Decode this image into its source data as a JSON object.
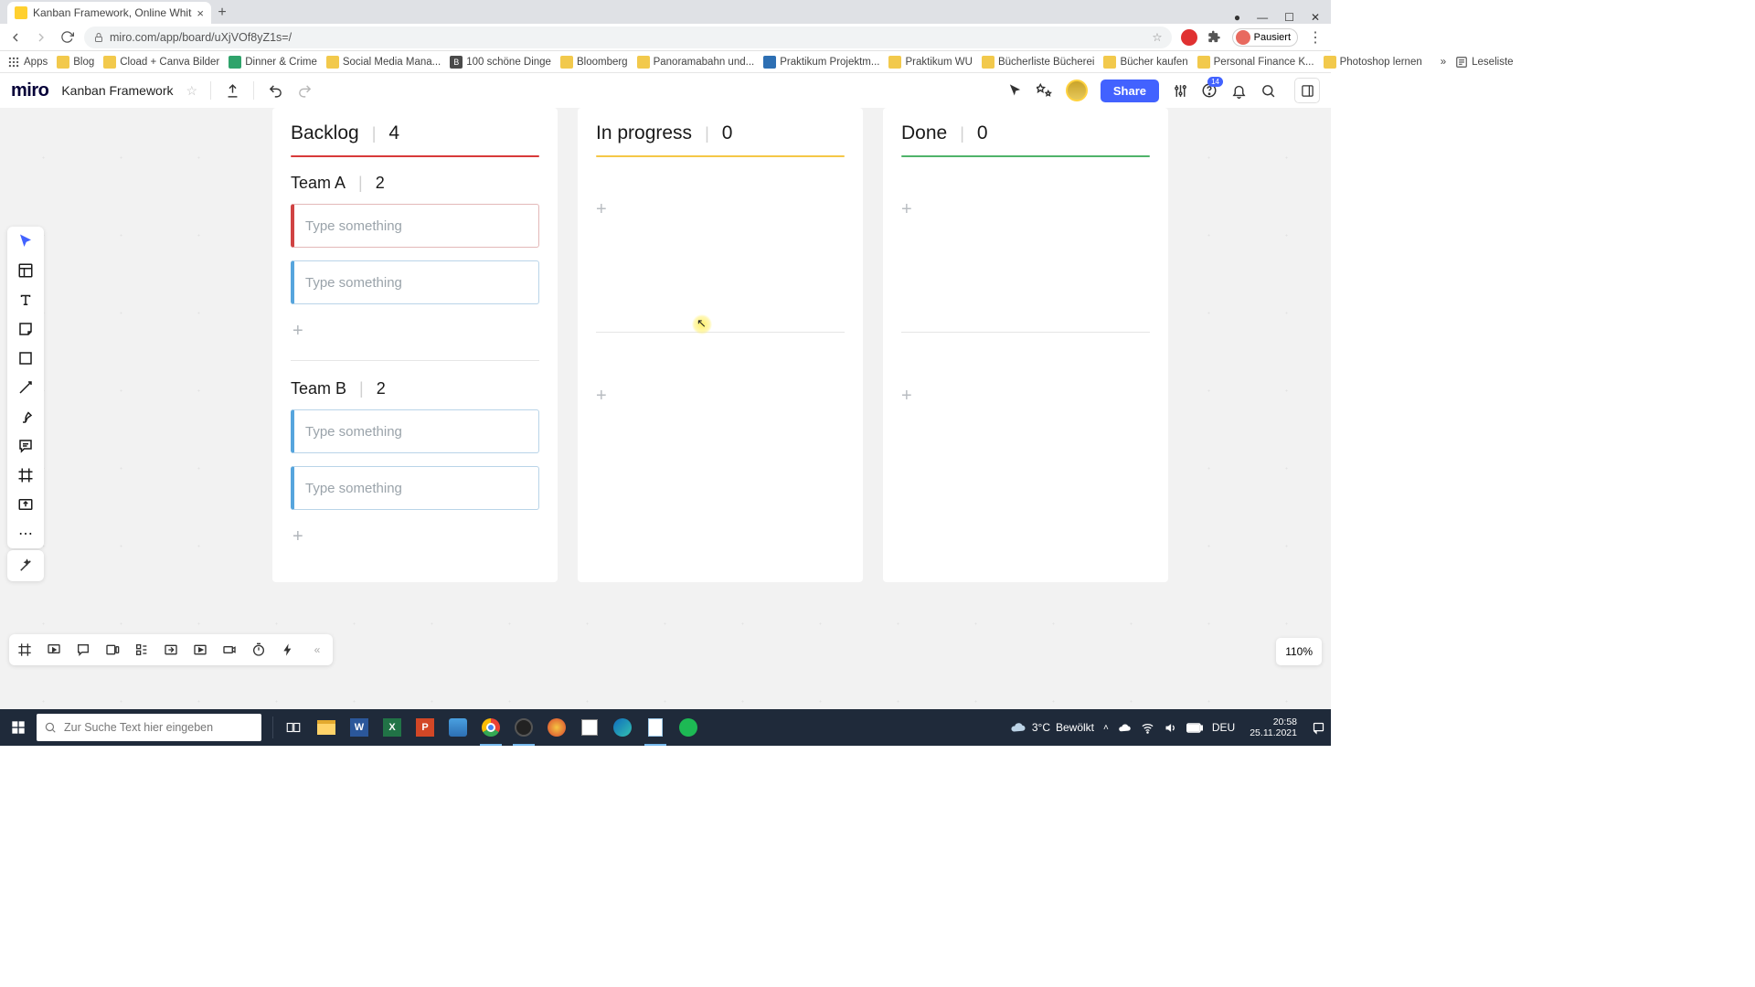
{
  "browser": {
    "tab_title": "Kanban Framework, Online Whit",
    "url": "miro.com/app/board/uXjVOf8yZ1s=/",
    "pausiert": "Pausiert",
    "bookmarks": [
      "Apps",
      "Blog",
      "Cload + Canva Bilder",
      "Dinner & Crime",
      "Social Media Mana...",
      "100 schöne Dinge",
      "Bloomberg",
      "Panoramabahn und...",
      "Praktikum Projektm...",
      "Praktikum WU",
      "Bücherliste Bücherei",
      "Bücher kaufen",
      "Personal Finance K...",
      "Photoshop lernen"
    ],
    "readlist": "Leseliste",
    "more": "»"
  },
  "miro": {
    "logo": "miro",
    "board_name": "Kanban Framework",
    "share": "Share",
    "notif_badge": "14",
    "zoom": "110%"
  },
  "kanban": {
    "columns": [
      {
        "title": "Backlog",
        "count": "4",
        "accent": "acc-red"
      },
      {
        "title": "In progress",
        "count": "0",
        "accent": "acc-yellow"
      },
      {
        "title": "Done",
        "count": "0",
        "accent": "acc-green"
      }
    ],
    "swimlanes": [
      {
        "title": "Team A",
        "count": "2"
      },
      {
        "title": "Team B",
        "count": "2"
      }
    ],
    "card_placeholder": "Type something",
    "plus": "+"
  },
  "taskbar": {
    "search_placeholder": "Zur Suche Text hier eingeben",
    "weather_temp": "3°C",
    "weather_text": "Bewölkt",
    "lang": "DEU",
    "time": "20:58",
    "date": "25.11.2021"
  }
}
